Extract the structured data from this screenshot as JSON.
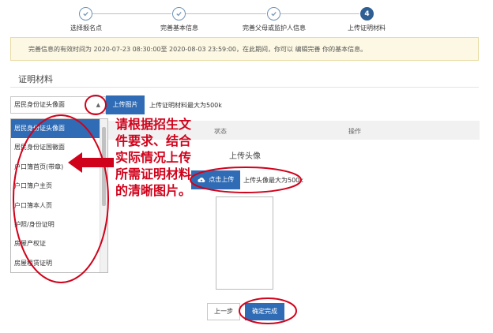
{
  "steps": [
    {
      "label": "选择报名点",
      "state": "done"
    },
    {
      "label": "完善基本信息",
      "state": "done"
    },
    {
      "label": "完善父母或监护人信息",
      "state": "done"
    },
    {
      "label": "上传证明材料",
      "state": "active",
      "number": "4"
    }
  ],
  "notice": "完善信息的有效时间为 2020-07-23 08:30:00至 2020-08-03 23:59:00，在此期间，你可以 编辑完善 你的基本信息。",
  "section_title": "证明材料",
  "material_select": {
    "value": "居民身份证头像面",
    "options": [
      "居民身份证头像面",
      "居民身份证国徽面",
      "户口簿首页(带章)",
      "户口簿户主页",
      "户口簿本人页",
      "护照/身份证明",
      "房屋产权证",
      "房屋租赁证明"
    ]
  },
  "upload_button": "上传图片",
  "upload_hint": "上传证明材料最大为500k",
  "table": {
    "status_header": "状态",
    "action_header": "操作"
  },
  "annotation": "请根据招生文件要求、结合实际情况上传所需证明材料的清晰图片。",
  "avatar": {
    "title": "上传头像",
    "button": "点击上传",
    "hint": "上传头像最大为500k"
  },
  "nav": {
    "prev": "上一步",
    "confirm": "确定完成"
  },
  "colors": {
    "primary": "#2f6cb5",
    "annotation_red": "#d0021b",
    "notice_bg": "#fcf8e3"
  }
}
